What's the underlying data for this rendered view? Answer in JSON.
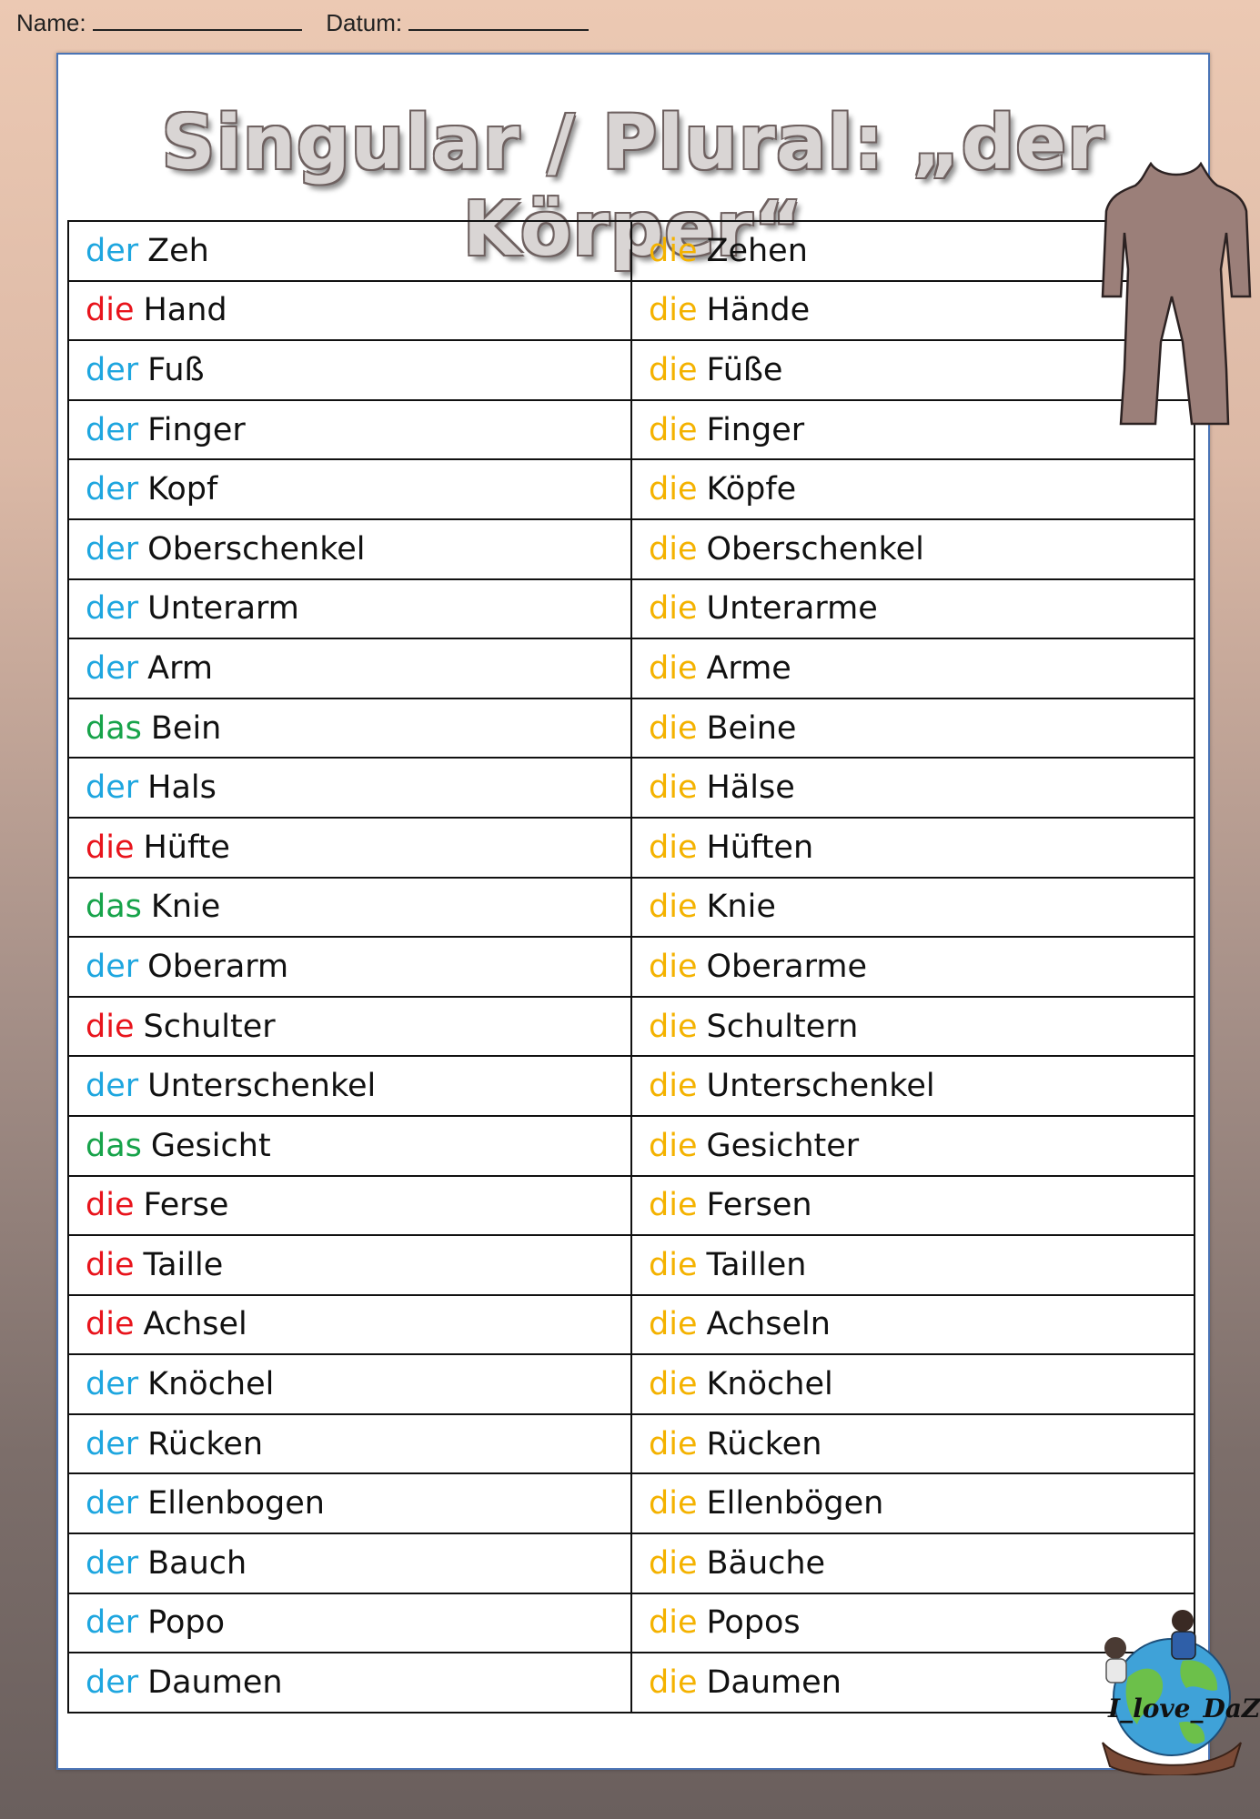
{
  "header": {
    "name_label": "Name:",
    "date_label": "Datum:"
  },
  "title": "Singular / Plural: „der Körper“",
  "rows": [
    {
      "sg_article": "der",
      "sg_noun": "Zeh",
      "pl_article": "die",
      "pl_noun": "Zehen"
    },
    {
      "sg_article": "die",
      "sg_noun": "Hand",
      "pl_article": "die",
      "pl_noun": "Hände"
    },
    {
      "sg_article": "der",
      "sg_noun": "Fuß",
      "pl_article": "die",
      "pl_noun": "Füße"
    },
    {
      "sg_article": "der",
      "sg_noun": "Finger",
      "pl_article": "die",
      "pl_noun": "Finger"
    },
    {
      "sg_article": "der",
      "sg_noun": "Kopf",
      "pl_article": "die",
      "pl_noun": "Köpfe"
    },
    {
      "sg_article": "der",
      "sg_noun": "Oberschenkel",
      "pl_article": "die",
      "pl_noun": "Oberschenkel"
    },
    {
      "sg_article": "der",
      "sg_noun": "Unterarm",
      "pl_article": "die",
      "pl_noun": "Unterarme"
    },
    {
      "sg_article": "der",
      "sg_noun": "Arm",
      "pl_article": "die",
      "pl_noun": "Arme"
    },
    {
      "sg_article": "das",
      "sg_noun": "Bein",
      "pl_article": "die",
      "pl_noun": "Beine"
    },
    {
      "sg_article": "der",
      "sg_noun": "Hals",
      "pl_article": "die",
      "pl_noun": "Hälse"
    },
    {
      "sg_article": "die",
      "sg_noun": "Hüfte",
      "pl_article": "die",
      "pl_noun": "Hüften"
    },
    {
      "sg_article": "das",
      "sg_noun": "Knie",
      "pl_article": "die",
      "pl_noun": "Knie"
    },
    {
      "sg_article": "der",
      "sg_noun": "Oberarm",
      "pl_article": "die",
      "pl_noun": "Oberarme"
    },
    {
      "sg_article": "die",
      "sg_noun": "Schulter",
      "pl_article": "die",
      "pl_noun": "Schultern"
    },
    {
      "sg_article": "der",
      "sg_noun": "Unterschenkel",
      "pl_article": "die",
      "pl_noun": "Unterschenkel"
    },
    {
      "sg_article": "das",
      "sg_noun": "Gesicht",
      "pl_article": "die",
      "pl_noun": "Gesichter"
    },
    {
      "sg_article": "die",
      "sg_noun": "Ferse",
      "pl_article": "die",
      "pl_noun": "Fersen"
    },
    {
      "sg_article": "die",
      "sg_noun": "Taille",
      "pl_article": "die",
      "pl_noun": "Taillen"
    },
    {
      "sg_article": "die",
      "sg_noun": "Achsel",
      "pl_article": "die",
      "pl_noun": "Achseln"
    },
    {
      "sg_article": "der",
      "sg_noun": "Knöchel",
      "pl_article": "die",
      "pl_noun": "Knöchel"
    },
    {
      "sg_article": "der",
      "sg_noun": "Rücken",
      "pl_article": "die",
      "pl_noun": "Rücken"
    },
    {
      "sg_article": "der",
      "sg_noun": "Ellenbogen",
      "pl_article": "die",
      "pl_noun": "Ellenbögen"
    },
    {
      "sg_article": "der",
      "sg_noun": "Bauch",
      "pl_article": "die",
      "pl_noun": "Bäuche"
    },
    {
      "sg_article": "der",
      "sg_noun": "Popo",
      "pl_article": "die",
      "pl_noun": "Popos"
    },
    {
      "sg_article": "der",
      "sg_noun": "Daumen",
      "pl_article": "die",
      "pl_noun": "Daumen"
    }
  ],
  "colors": {
    "der": "#1ea6df",
    "die_singular": "#e8141c",
    "das": "#17a34a",
    "die_plural": "#f4b200",
    "frame_border": "#4a74b5"
  },
  "logo": {
    "text": "I_love_DaZ",
    "icon": "globe-with-children-logo"
  },
  "illustration": {
    "icon": "body-torso-icon"
  }
}
